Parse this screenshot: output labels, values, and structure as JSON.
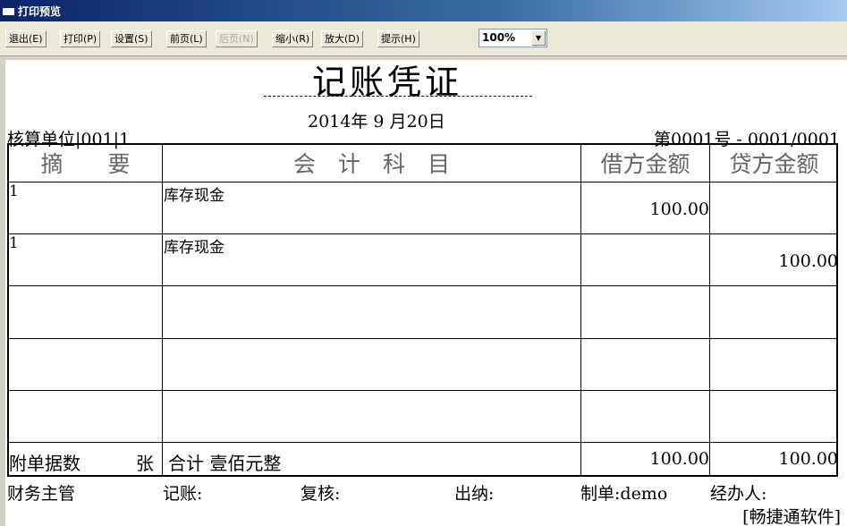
{
  "window": {
    "title": "打印预览"
  },
  "toolbar": {
    "exit": "退出(E)",
    "print": "打印(P)",
    "settings": "设置(S)",
    "prev": "前页(L)",
    "next": "后页(N)",
    "zoom_out": "缩小(R)",
    "zoom_in": "放大(D)",
    "hint": "提示(H)",
    "zoom_value": "100%"
  },
  "voucher": {
    "title": "记账凭证",
    "date": "2014年 9 月20日",
    "unit": "核算单位|001|1",
    "number": "第0001号 - 0001/0001",
    "headers": {
      "summary": "摘　　要",
      "account": "会　计　科　目",
      "debit": "借方金额",
      "credit": "贷方金额"
    },
    "rows": [
      {
        "summary": "1",
        "account": "库存现金",
        "debit": "100.00",
        "credit": ""
      },
      {
        "summary": "1",
        "account": "库存现金",
        "debit": "",
        "credit": "100.00"
      },
      {
        "summary": "",
        "account": "",
        "debit": "",
        "credit": ""
      },
      {
        "summary": "",
        "account": "",
        "debit": "",
        "credit": ""
      },
      {
        "summary": "",
        "account": "",
        "debit": "",
        "credit": ""
      }
    ],
    "footer": {
      "attachments_label": "附单据数",
      "attachments_unit": "张",
      "total_label": "合计 壹佰元整",
      "total_debit": "100.00",
      "total_credit": "100.00"
    },
    "signatures": {
      "supervisor": "财务主管",
      "bookkeeper": "记账:",
      "reviewer": "复核:",
      "cashier": "出纳:",
      "preparer": "制单:demo",
      "handler": "经办人:"
    },
    "brand": "[畅捷通软件]"
  }
}
